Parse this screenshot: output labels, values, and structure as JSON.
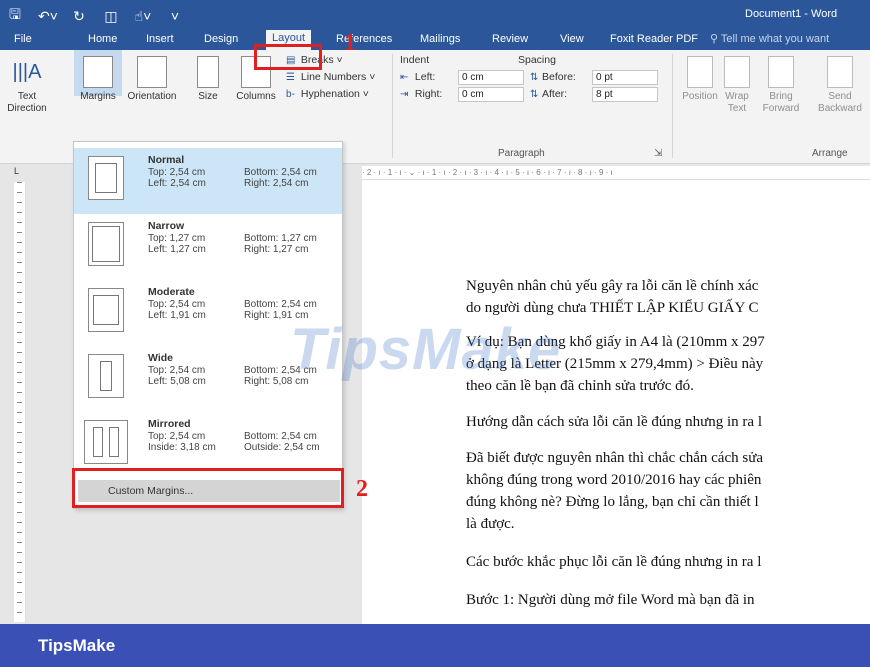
{
  "window": {
    "title": "Document1 - Word"
  },
  "quick_access": [
    "save-icon",
    "undo-icon",
    "redo-icon",
    "layout-icon",
    "touch-icon",
    "customize-icon"
  ],
  "tabs": [
    {
      "label": "File"
    },
    {
      "label": "Home"
    },
    {
      "label": "Insert"
    },
    {
      "label": "Design"
    },
    {
      "label": "Layout"
    },
    {
      "label": "References"
    },
    {
      "label": "Mailings"
    },
    {
      "label": "Review"
    },
    {
      "label": "View"
    },
    {
      "label": "Foxit Reader PDF"
    }
  ],
  "tell_me": "Tell me what you want",
  "ribbon": {
    "text_direction": "Text Direction",
    "margins": "Margins",
    "orientation": "Orientation",
    "size": "Size",
    "columns": "Columns",
    "breaks": "Breaks",
    "line_numbers": "Line Numbers",
    "hyphenation": "Hyphenation",
    "indent_label": "Indent",
    "spacing_label": "Spacing",
    "left_label": "Left:",
    "right_label": "Right:",
    "before_label": "Before:",
    "after_label": "After:",
    "left_value": "0 cm",
    "right_value": "0 cm",
    "before_value": "0 pt",
    "after_value": "8 pt",
    "paragraph_group": "Paragraph",
    "position": "Position",
    "wrap_text": "Wrap Text",
    "bring_forward": "Bring Forward",
    "send_backward": "Send Backward",
    "arrange_group": "Arrange"
  },
  "ruler_text": "· 2 · ı · 1 · ı · ⌄ · ı · 1 · ı · 2 · ı · 3 · ı · 4 · ı · 5 · ı · 6 · ı · 7 · ı · 8 · ı · 9 · ı",
  "margins_menu": [
    {
      "name": "Normal",
      "l1": "Top:  2,54 cm",
      "l2": "Left:  2,54 cm",
      "r1": "Bottom: 2,54 cm",
      "r2": "Right: 2,54 cm"
    },
    {
      "name": "Narrow",
      "l1": "Top:  1,27 cm",
      "l2": "Left:  1,27 cm",
      "r1": "Bottom: 1,27 cm",
      "r2": "Right: 1,27 cm"
    },
    {
      "name": "Moderate",
      "l1": "Top:  2,54 cm",
      "l2": "Left:  1,91 cm",
      "r1": "Bottom: 2,54 cm",
      "r2": "Right: 1,91 cm"
    },
    {
      "name": "Wide",
      "l1": "Top:  2,54 cm",
      "l2": "Left:  5,08 cm",
      "r1": "Bottom: 2,54 cm",
      "r2": "Right: 5,08 cm"
    },
    {
      "name": "Mirrored",
      "l1": "Top:  2,54 cm",
      "l2": "Inside: 3,18 cm",
      "r1": "Bottom: 2,54 cm",
      "r2": "Outside: 2,54 cm"
    }
  ],
  "custom_margins": "Custom Margins...",
  "annotations": {
    "one": "1",
    "two": "2"
  },
  "document_lines": [
    "Nguyên nhân chủ yếu gây ra lỗi căn lề chính xác",
    "do người dùng chưa THIẾT LẬP KIỂU GIẤY C",
    "Ví dụ: Bạn dùng khổ giấy in A4 là (210mm x 297",
    "ở dạng là Letter (215mm x 279,4mm) > Điều này",
    "theo căn lề bạn đã chỉnh sửa trước đó.",
    "Hướng dẫn cách sửa lỗi căn lề đúng nhưng in ra l",
    "Đã biết được nguyên nhân thì chắc chắn cách sửa",
    "không đúng trong word 2010/2016 hay các phiên",
    "đúng không nè? Đừng lo lắng, bạn chỉ cần thiết l",
    "là được.",
    "Các bước khắc phục lỗi căn lề đúng nhưng in ra l",
    "Bước 1: Người dùng mở file Word mà bạn đã in"
  ],
  "watermark": "TipsMake",
  "footer": "TipsMake",
  "colors": {
    "titlebar": "#2b579a",
    "annotation": "#e02020",
    "footer": "#3b50b5",
    "selected": "#cde6f7"
  }
}
